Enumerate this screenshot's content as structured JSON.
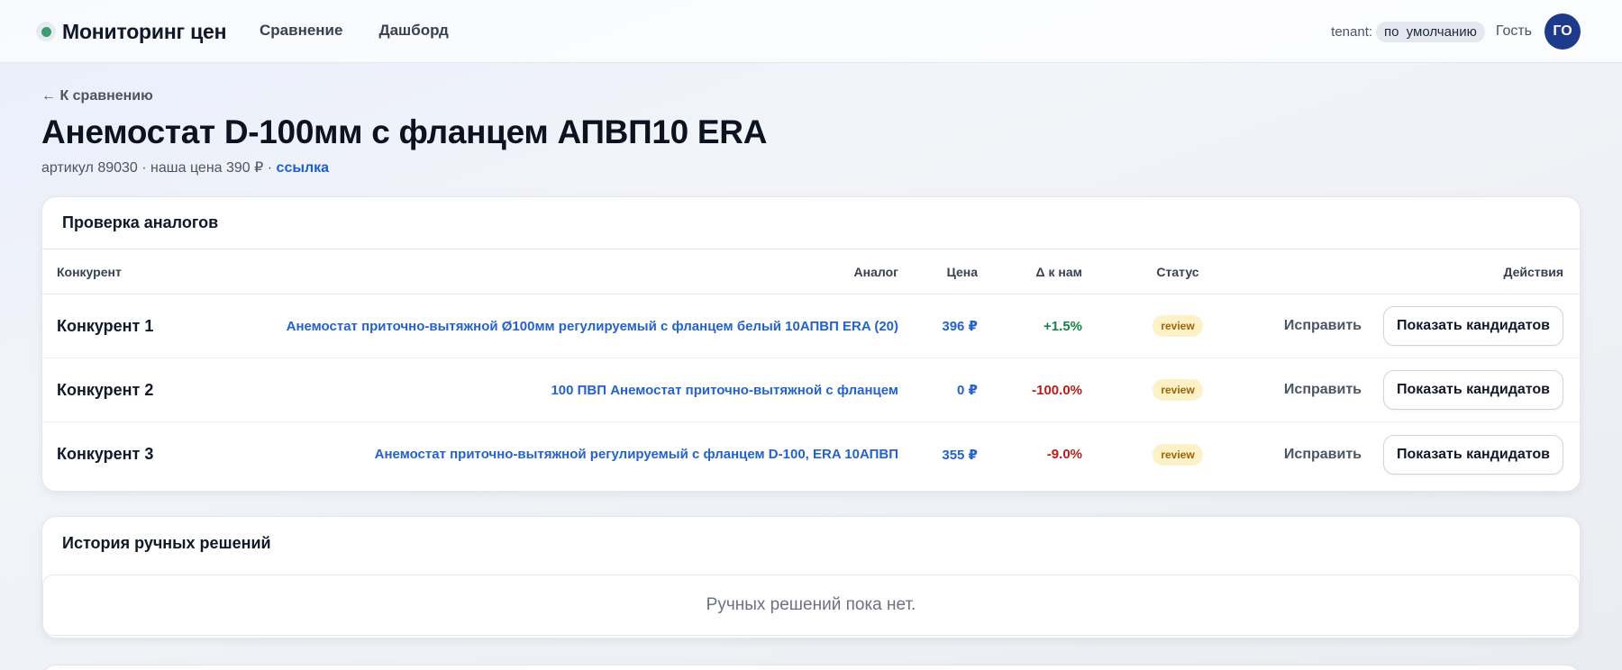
{
  "header": {
    "brand": "Мониторинг цен",
    "nav": [
      "Сравнение",
      "Дашборд"
    ],
    "tenant_label": "tenant:",
    "tenant_value": "по умолчанию",
    "user_name": "Гость",
    "avatar_initials": "ГО"
  },
  "page": {
    "back_link": "← К сравнению",
    "title": "Анемостат D-100мм с фланцем АПВП10 ERA",
    "sub_prefix": "артикул 89030 · наша цена 390 ₽ · ",
    "sub_link": "ссылка"
  },
  "analogs": {
    "title": "Проверка аналогов",
    "columns": {
      "competitor": "Конкурент",
      "analog": "Аналог",
      "price": "Цена",
      "delta": "Δ к нам",
      "status": "Статус",
      "actions": "Действия"
    },
    "rows": [
      {
        "competitor": "Конкурент 1",
        "analog": "Анемостат приточно-вытяжной Ø100мм регулируемый с фланцем белый 10АПВП ERA (20)",
        "price": "396 ₽",
        "delta": "+1.5%",
        "status": "review",
        "fix": "Исправить",
        "candidates": "Показать кандидатов"
      },
      {
        "competitor": "Конкурент 2",
        "analog": "100 ПВП Анемостат приточно-вытяжной с фланцем",
        "price": "0 ₽",
        "delta": "-100.0%",
        "status": "review",
        "fix": "Исправить",
        "candidates": "Показать кандидатов"
      },
      {
        "competitor": "Конкурент 3",
        "analog": "Анемостат приточно-вытяжной регулируемый с фланцем D-100, ERA 10АПВП",
        "price": "355 ₽",
        "delta": "-9.0%",
        "status": "review",
        "fix": "Исправить",
        "candidates": "Показать кандидатов"
      }
    ]
  },
  "history": {
    "title": "История ручных решений",
    "empty": "Ручных решений пока нет."
  },
  "colors": {
    "accent": "#2563c9",
    "positive": "#16834a",
    "negative": "#b91c1c",
    "badge_bg": "#fdf1c7",
    "avatar_bg": "#1e3a8a"
  }
}
